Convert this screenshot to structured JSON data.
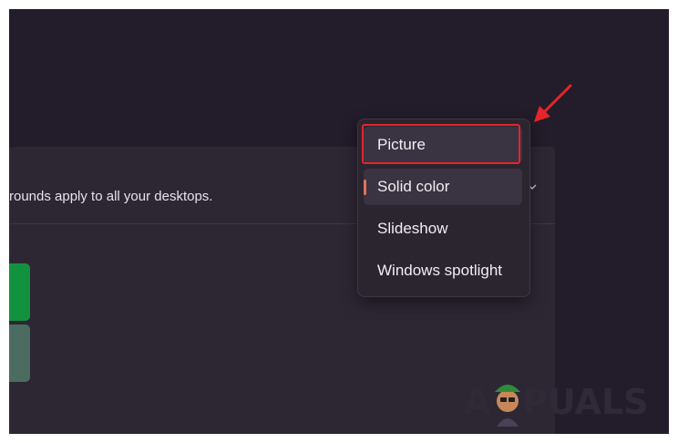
{
  "card": {
    "description": "rounds apply to all your desktops."
  },
  "menu": {
    "items": [
      {
        "label": "Picture",
        "state": "hover"
      },
      {
        "label": "Solid color",
        "state": "selected"
      },
      {
        "label": "Slideshow",
        "state": "normal"
      },
      {
        "label": "Windows spotlight",
        "state": "normal"
      }
    ]
  },
  "swatches": [
    {
      "name": "green",
      "color": "#12923f"
    },
    {
      "name": "slate",
      "color": "#4c6b61"
    }
  ],
  "annotation": {
    "highlight_color": "#e4252a",
    "arrow_color": "#e4252a"
  },
  "watermark": {
    "text": "A PUALS"
  },
  "colors": {
    "background": "#231c2a",
    "card": "#2d2734",
    "menu": "#2b2530",
    "selection_indicator": "#e0735c"
  }
}
